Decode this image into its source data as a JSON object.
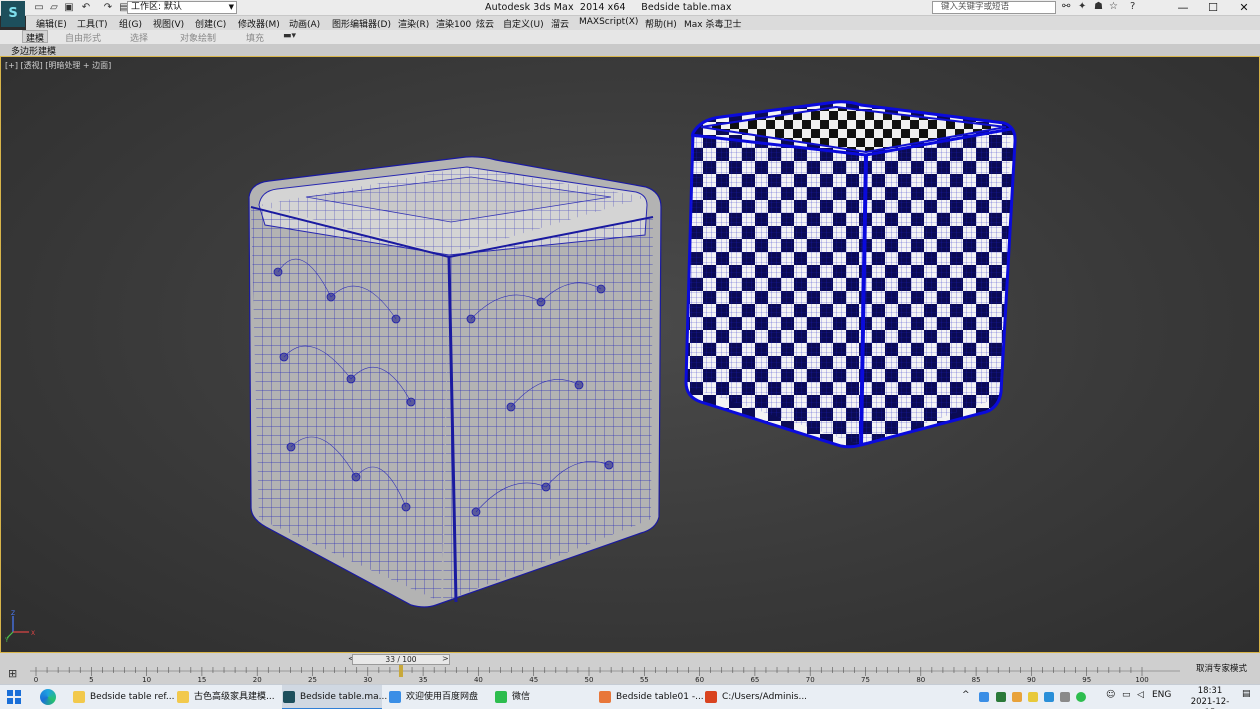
{
  "app": {
    "logo_letter": "S",
    "title": "Autodesk 3ds Max  2014 x64     Bedside table.max",
    "workspace_label": "工作区: 默认",
    "search_placeholder": "键入关键字或短语"
  },
  "quick_access": {
    "icons": [
      "new-icon",
      "open-icon",
      "save-icon",
      "undo-icon",
      "redo-icon",
      "project-icon"
    ]
  },
  "window_controls": {
    "minimize": "—",
    "maximize": "☐",
    "close": "✕"
  },
  "menu": {
    "items": [
      "编辑(E)",
      "工具(T)",
      "组(G)",
      "视图(V)",
      "创建(C)",
      "修改器(M)",
      "动画(A)",
      "图形编辑器(D)",
      "渲染(R)",
      "渲染100",
      "炫云",
      "自定义(U)",
      "溜云",
      "MAXScript(X)",
      "帮助(H)",
      "Max 杀毒卫士"
    ]
  },
  "ribbon": {
    "tabs": [
      "建模",
      "自由形式",
      "选择",
      "对象绘制",
      "填充"
    ],
    "active_tab": "建模",
    "subtitle": "多边形建模"
  },
  "viewport": {
    "label": "[+] [透视] [明暗处理 + 边面]",
    "axis_labels": [
      "X",
      "Y",
      "Z"
    ]
  },
  "timeline": {
    "frame_indicator": "33 / 100",
    "current_frame": 33,
    "total_frames": 100,
    "ticks": [
      "0",
      "5",
      "10",
      "15",
      "20",
      "25",
      "30",
      "35",
      "40",
      "45",
      "50",
      "55",
      "60",
      "65",
      "70",
      "75",
      "80",
      "85",
      "90",
      "95",
      "100"
    ],
    "status": "取消专家模式"
  },
  "taskbar": {
    "items": [
      {
        "label": "Bedside table ref...",
        "color": "#f2c94c",
        "active": false
      },
      {
        "label": "古色高级家具建模...",
        "color": "#f2c94c",
        "active": false
      },
      {
        "label": "Bedside table.ma...",
        "color": "#1d4f5c",
        "active": true
      },
      {
        "label": "欢迎使用百度网盘",
        "color": "#3a8ee6",
        "active": false
      },
      {
        "label": "微信",
        "color": "#2dbd4e",
        "active": false
      },
      {
        "label": "Bedside table01 -...",
        "color": "#e8773a",
        "active": false
      },
      {
        "label": "C:/Users/Adminis...",
        "color": "#d9431f",
        "active": false
      }
    ],
    "lang": "ENG",
    "time": "18:31",
    "date": "2021-12-15"
  }
}
